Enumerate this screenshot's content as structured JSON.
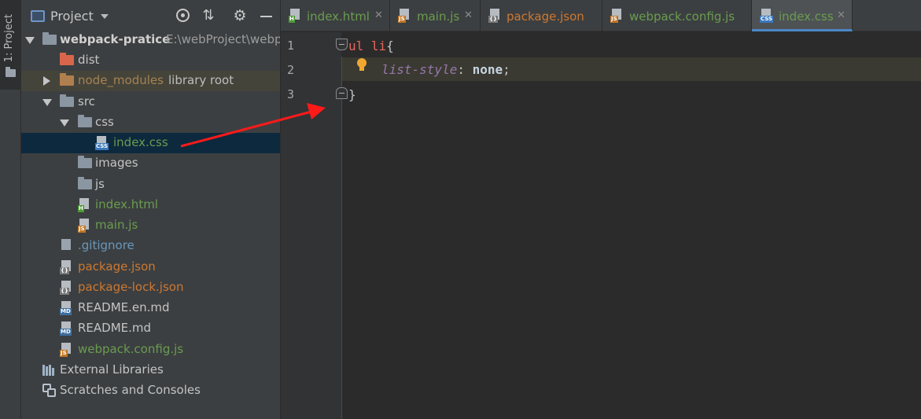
{
  "toolstrip": {
    "tab_label": "1: Project"
  },
  "project_panel": {
    "title": "Project",
    "tree": {
      "root": {
        "name": "webpack-pratice",
        "path": "E:\\webProject\\webp"
      },
      "dist": "dist",
      "node_modules": {
        "name": "node_modules",
        "note": "library root"
      },
      "src": "src",
      "css": "css",
      "index_css": "index.css",
      "images": "images",
      "js_folder": "js",
      "index_html": "index.html",
      "main_js": "main.js",
      "gitignore": ".gitignore",
      "package_json": "package.json",
      "package_lock": "package-lock.json",
      "readme_en": "README.en.md",
      "readme": "README.md",
      "webpack_config": "webpack.config.js",
      "external_libraries": "External Libraries",
      "scratches": "Scratches and Consoles"
    }
  },
  "tabs": [
    {
      "label": "index.html",
      "icon": "html-file-icon"
    },
    {
      "label": "main.js",
      "icon": "js-file-icon"
    },
    {
      "label": "package.json",
      "icon": "json-file-icon"
    },
    {
      "label": "webpack.config.js",
      "icon": "js-file-icon"
    },
    {
      "label": "index.css",
      "icon": "css-file-icon",
      "active": true
    }
  ],
  "icons": {
    "css": "CSS",
    "js": "JS",
    "html": "H",
    "md": "MD",
    "json": "{}"
  },
  "editor": {
    "line_numbers": [
      "1",
      "2",
      "3"
    ],
    "line1": {
      "selector": "ul li",
      "brace": "{"
    },
    "line2": {
      "property": "list-style",
      "colon": ":",
      "value": "none",
      "semicolon": ";"
    },
    "line3": {
      "brace": "}"
    }
  },
  "colors": {
    "accent": "#4a88c7",
    "selection": "#0d293e",
    "annotation_arrow": "#ff1a1a"
  }
}
